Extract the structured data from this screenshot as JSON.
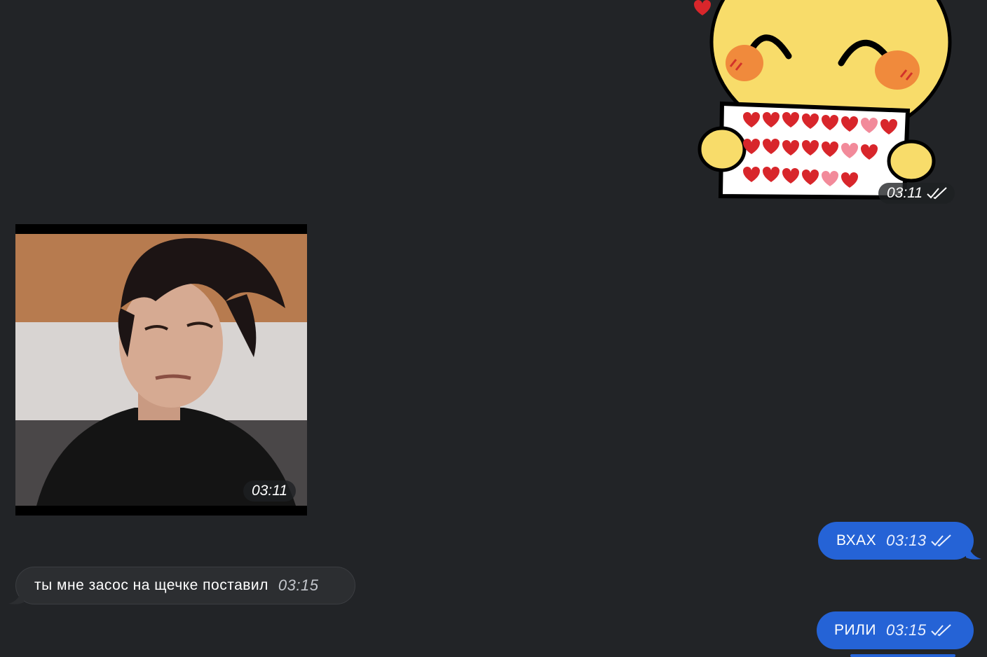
{
  "messages": [
    {
      "type": "sticker",
      "direction": "outgoing",
      "time": "03:11",
      "status_icon": "double-check-icon"
    },
    {
      "type": "photo",
      "direction": "incoming",
      "time": "03:11"
    },
    {
      "type": "text",
      "direction": "outgoing",
      "text": "ВХАХ",
      "time": "03:13",
      "status_icon": "double-check-icon"
    },
    {
      "type": "text",
      "direction": "incoming",
      "text": "ты мне засос на щечке поставил",
      "time": "03:15"
    },
    {
      "type": "text",
      "direction": "outgoing",
      "text": "РИЛИ",
      "time": "03:15",
      "status_icon": "double-check-icon"
    }
  ],
  "colors": {
    "background": "#222427",
    "outgoing_bubble": "#2563d6",
    "incoming_bubble": "#2c2e31"
  }
}
